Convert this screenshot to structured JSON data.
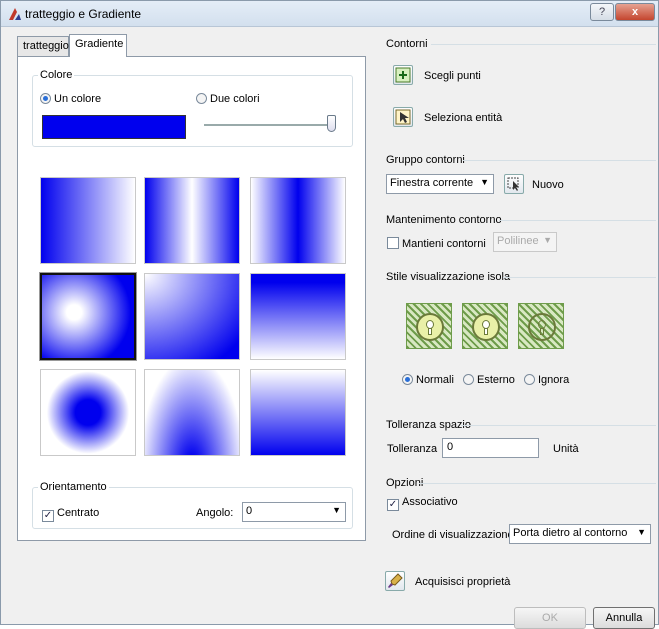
{
  "window": {
    "title": "tratteggio e Gradiente",
    "help_glyph": "?",
    "close_glyph": "x"
  },
  "tabs": [
    "tratteggio",
    "Gradiente"
  ],
  "colore": {
    "label": "Colore",
    "one_color_label": "Un colore",
    "two_colors_label": "Due colori",
    "selected": "Un colore",
    "color": "#0000ee",
    "shade_level": 1.0
  },
  "gradients": [
    {
      "name": "linear-horizontal",
      "selected": false
    },
    {
      "name": "cylinder-horizontal",
      "selected": false
    },
    {
      "name": "inverted-cylinder-horizontal",
      "selected": false
    },
    {
      "name": "spherical",
      "selected": true
    },
    {
      "name": "hemispherical",
      "selected": false
    },
    {
      "name": "curved",
      "selected": false
    },
    {
      "name": "inverted-spherical",
      "selected": false
    },
    {
      "name": "inverted-hemispherical",
      "selected": false
    },
    {
      "name": "inverted-curved",
      "selected": false
    }
  ],
  "orientamento": {
    "label": "Orientamento",
    "centrato_label": "Centrato",
    "centrato_checked": true,
    "angolo_label": "Angolo:",
    "angolo_value": "0"
  },
  "contorni": {
    "label": "Contorni",
    "scegli_punti": "Scegli punti",
    "seleziona_entita": "Seleziona entità"
  },
  "gruppo_contorni": {
    "label": "Gruppo contorni",
    "select_value": "Finestra corrente",
    "nuovo": "Nuovo"
  },
  "mantenimento": {
    "label": "Mantenimento contorno",
    "mantieni_label": "Mantieni contorni",
    "mantieni_checked": false,
    "type_value": "Polilinee"
  },
  "stile_isola": {
    "label": "Stile visualizzazione isola",
    "options": [
      "Normali",
      "Esterno",
      "Ignora"
    ],
    "selected": "Normali"
  },
  "tolleranza": {
    "label": "Tolleranza spazio",
    "field_label": "Tolleranza",
    "value": "0",
    "unit": "Unità"
  },
  "opzioni": {
    "label": "Opzioni",
    "associativo_label": "Associativo",
    "associativo_checked": true,
    "ordine_label": "Ordine di visualizzazione",
    "ordine_value": "Porta dietro al contorno"
  },
  "acquisisci": "Acquisisci proprietà",
  "buttons": {
    "ok": "OK",
    "annulla": "Annulla"
  }
}
